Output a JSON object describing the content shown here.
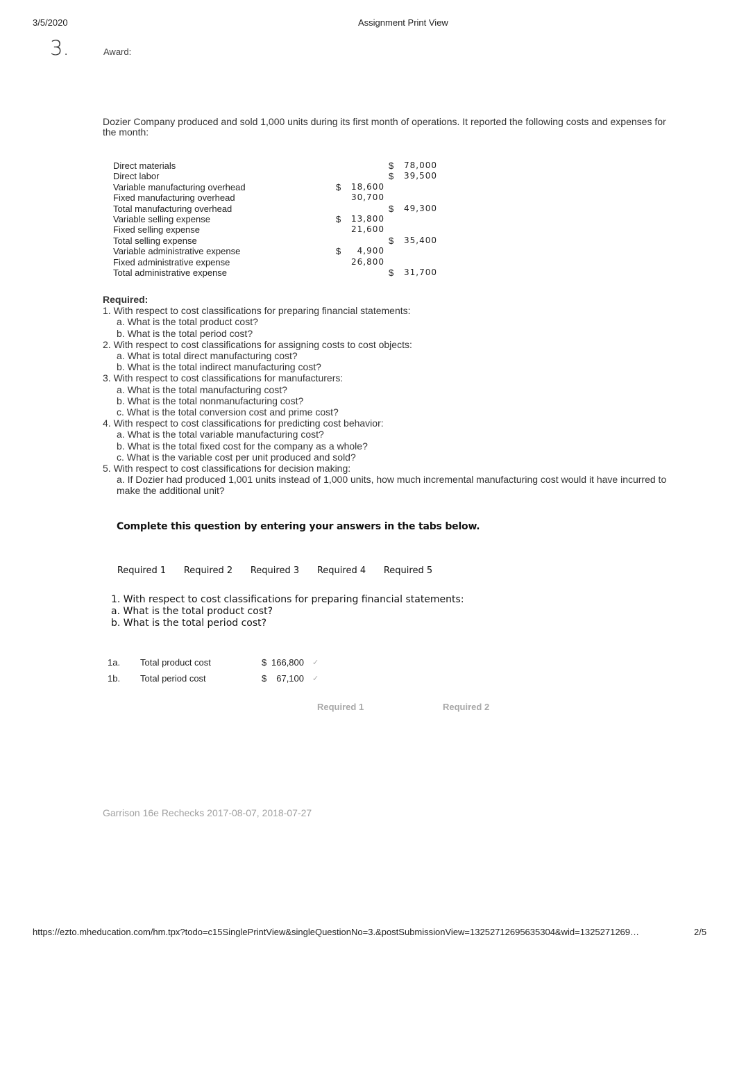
{
  "header": {
    "date": "3/5/2020",
    "title": "Assignment Print View"
  },
  "question": {
    "number": "3.",
    "award_label": "Award:",
    "intro": "Dozier Company produced and sold 1,000 units during its first month of operations. It reported the following costs and expenses for the month:"
  },
  "cost_table": [
    {
      "label": "Direct materials",
      "dollar1": "",
      "col1": "",
      "dollar2": "$",
      "col2": "78,000"
    },
    {
      "label": "Direct labor",
      "dollar1": "",
      "col1": "",
      "dollar2": "$",
      "col2": "39,500"
    },
    {
      "label": "Variable manufacturing overhead",
      "dollar1": "$",
      "col1": "18,600",
      "dollar2": "",
      "col2": ""
    },
    {
      "label": "Fixed manufacturing overhead",
      "dollar1": "",
      "col1": "30,700",
      "dollar2": "",
      "col2": ""
    },
    {
      "label": "Total manufacturing overhead",
      "dollar1": "",
      "col1": "",
      "dollar2": "$",
      "col2": "49,300"
    },
    {
      "label": "Variable selling expense",
      "dollar1": "$",
      "col1": "13,800",
      "dollar2": "",
      "col2": ""
    },
    {
      "label": "Fixed selling expense",
      "dollar1": "",
      "col1": "21,600",
      "dollar2": "",
      "col2": ""
    },
    {
      "label": "Total selling expense",
      "dollar1": "",
      "col1": "",
      "dollar2": "$",
      "col2": "35,400"
    },
    {
      "label": "Variable administrative expense",
      "dollar1": "$",
      "col1": "4,900",
      "dollar2": "",
      "col2": ""
    },
    {
      "label": "Fixed administrative expense",
      "dollar1": "",
      "col1": "26,800",
      "dollar2": "",
      "col2": ""
    },
    {
      "label": "Total administrative expense",
      "dollar1": "",
      "col1": "",
      "dollar2": "$",
      "col2": "31,700"
    }
  ],
  "required": {
    "heading": "Required:",
    "lines": [
      {
        "type": "q",
        "text": "1. With respect to cost classifications for preparing financial statements:"
      },
      {
        "type": "s",
        "text": "a. What is the total product cost?"
      },
      {
        "type": "s",
        "text": "b. What is the total period cost?"
      },
      {
        "type": "q",
        "text": "2. With respect to cost classifications for assigning costs to cost objects:"
      },
      {
        "type": "s",
        "text": "a. What is total direct manufacturing cost?"
      },
      {
        "type": "s",
        "text": "b. What is the total indirect manufacturing cost?"
      },
      {
        "type": "q",
        "text": "3. With respect to cost classifications for manufacturers:"
      },
      {
        "type": "s",
        "text": "a. What is the total manufacturing cost?"
      },
      {
        "type": "s",
        "text": "b. What is the total nonmanufacturing cost?"
      },
      {
        "type": "s",
        "text": "c. What is the total conversion cost and prime cost?"
      },
      {
        "type": "q",
        "text": "4. With respect to cost classifications for predicting cost behavior:"
      },
      {
        "type": "s",
        "text": "a. What is the total variable manufacturing cost?"
      },
      {
        "type": "s",
        "text": "b. What is the total fixed cost for the company as a whole?"
      },
      {
        "type": "s",
        "text": "c. What is the variable cost per unit produced and sold?"
      },
      {
        "type": "q",
        "text": "5. With respect to cost classifications for decision making:"
      },
      {
        "type": "s",
        "text": "a. If Dozier had produced 1,001 units instead of 1,000 units, how much incremental manufacturing cost would it have incurred to make the additional unit?"
      }
    ]
  },
  "instruction": "Complete this question by entering your answers in the tabs below.",
  "tabs": [
    "Required 1",
    "Required 2",
    "Required 3",
    "Required 4",
    "Required 5"
  ],
  "active_tab": {
    "prompt_lines": [
      "1. With respect to cost classifications for preparing financial statements:",
      "a. What is the total product cost?",
      "b. What is the total period cost?"
    ],
    "answers": [
      {
        "code": "1a.",
        "label": "Total product cost",
        "currency": "$",
        "value": "166,800",
        "status_icon": "check-icon",
        "status_glyph": "✓"
      },
      {
        "code": "1b.",
        "label": "Total period cost",
        "currency": "$",
        "value": "67,100",
        "status_icon": "check-icon",
        "status_glyph": "✓"
      }
    ]
  },
  "nav": {
    "prev_label": "Required 1",
    "next_label": "Required 2"
  },
  "credit": "Garrison 16e Rechecks 2017-08-07, 2018-07-27",
  "footer": {
    "url": "https://ezto.mheducation.com/hm.tpx?todo=c15SinglePrintView&singleQuestionNo=3.&postSubmissionView=13252712695635304&wid=1325271269…",
    "page": "2/5"
  }
}
